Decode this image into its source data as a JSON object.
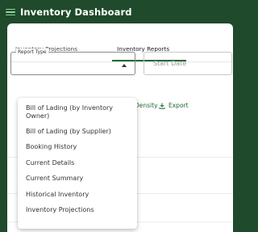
{
  "app": {
    "title": "Inventory Dashboard"
  },
  "tabs": [
    {
      "label": "Inventory Projections",
      "active": false
    },
    {
      "label": "Inventory Reports",
      "active": true
    }
  ],
  "report_type": {
    "legend": "Report Type",
    "value": ""
  },
  "start_date": {
    "placeholder": "Start Date"
  },
  "toolbar": {
    "density_label": "Density",
    "export_label": "Export"
  },
  "dropdown": {
    "options": [
      "Bill of Lading (by Inventory Owner)",
      "Bill of Lading (by Supplier)",
      "Booking History",
      "Current Details",
      "Current Summary",
      "Historical Inventory",
      "Inventory Projections"
    ]
  },
  "colors": {
    "header_bg": "#1f4a2b",
    "accent": "#1f6b34",
    "menu_icon": "#8fd39a"
  },
  "icons": {
    "menu": "hamburger-menu-icon",
    "caret": "caret-up-icon",
    "export": "download-icon"
  }
}
